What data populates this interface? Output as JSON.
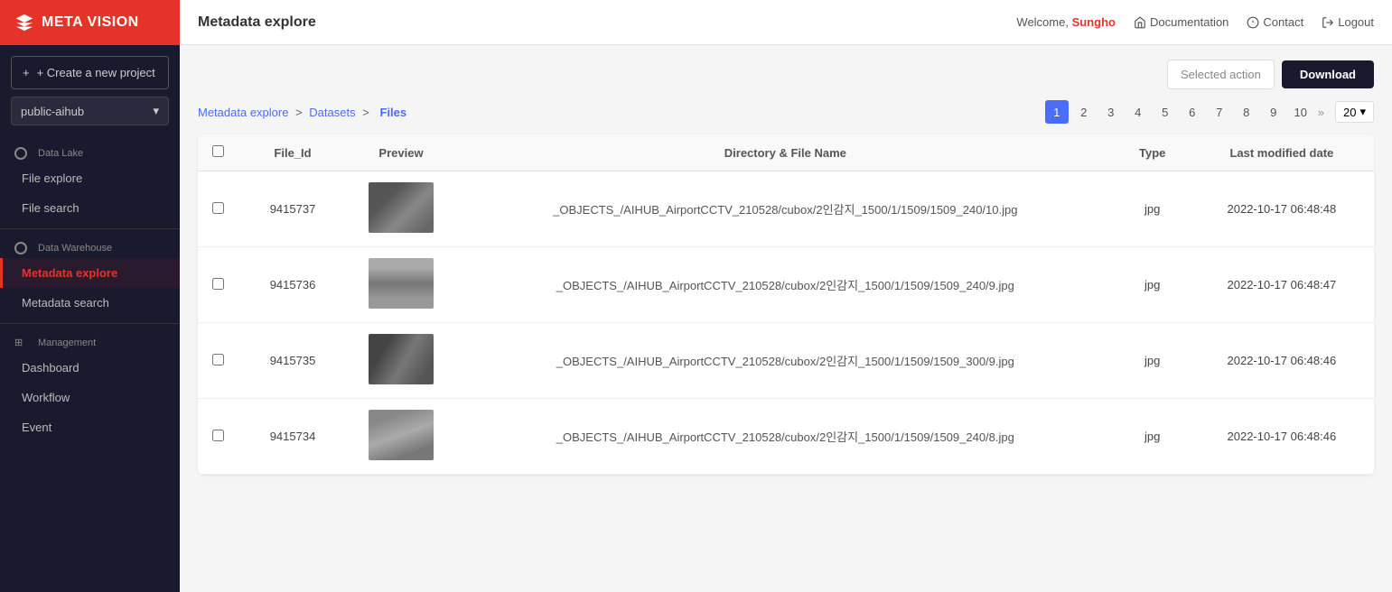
{
  "app": {
    "name": "META VISION"
  },
  "topbar": {
    "title": "Metadata explore",
    "welcome_text": "Welcome,",
    "username": "Sungho",
    "doc_label": "Documentation",
    "contact_label": "Contact",
    "logout_label": "Logout"
  },
  "sidebar": {
    "create_project_label": "+ Create a new project",
    "project_selector": "public-aihub",
    "sections": [
      {
        "label": "Data Lake",
        "items": [
          {
            "id": "file-explore",
            "label": "File explore",
            "active": false
          },
          {
            "id": "file-search",
            "label": "File search",
            "active": false
          }
        ]
      },
      {
        "label": "Data Warehouse",
        "items": [
          {
            "id": "metadata-explore",
            "label": "Metadata explore",
            "active": true
          },
          {
            "id": "metadata-search",
            "label": "Metadata search",
            "active": false
          }
        ]
      },
      {
        "label": "Management",
        "items": [
          {
            "id": "dashboard",
            "label": "Dashboard",
            "active": false
          },
          {
            "id": "workflow",
            "label": "Workflow",
            "active": false
          },
          {
            "id": "event",
            "label": "Event",
            "active": false
          }
        ]
      }
    ]
  },
  "action_bar": {
    "selected_action_label": "Selected action",
    "download_label": "Download"
  },
  "breadcrumb": {
    "parts": [
      "Metadata explore",
      "Datasets",
      "Files"
    ]
  },
  "pagination": {
    "pages": [
      1,
      2,
      3,
      4,
      5,
      6,
      7,
      8,
      9,
      10
    ],
    "current": 1,
    "page_size": 20
  },
  "table": {
    "columns": [
      "File_Id",
      "Preview",
      "Directory & File Name",
      "Type",
      "Last modified date"
    ],
    "rows": [
      {
        "file_id": "9415737",
        "thumb_class": "thumb-1",
        "path": "_OBJECTS_/AIHUB_AirportCCTV_210528/cubox/2인감지_1500/1/1509/1509_240/10.jpg",
        "type": "jpg",
        "modified": "2022-10-17 06:48:48"
      },
      {
        "file_id": "9415736",
        "thumb_class": "thumb-2",
        "path": "_OBJECTS_/AIHUB_AirportCCTV_210528/cubox/2인감지_1500/1/1509/1509_240/9.jpg",
        "type": "jpg",
        "modified": "2022-10-17 06:48:47"
      },
      {
        "file_id": "9415735",
        "thumb_class": "thumb-3",
        "path": "_OBJECTS_/AIHUB_AirportCCTV_210528/cubox/2인감지_1500/1/1509/1509_300/9.jpg",
        "type": "jpg",
        "modified": "2022-10-17 06:48:46"
      },
      {
        "file_id": "9415734",
        "thumb_class": "thumb-4",
        "path": "_OBJECTS_/AIHUB_AirportCCTV_210528/cubox/2인감지_1500/1/1509/1509_240/8.jpg",
        "type": "jpg",
        "modified": "2022-10-17 06:48:46"
      }
    ]
  }
}
